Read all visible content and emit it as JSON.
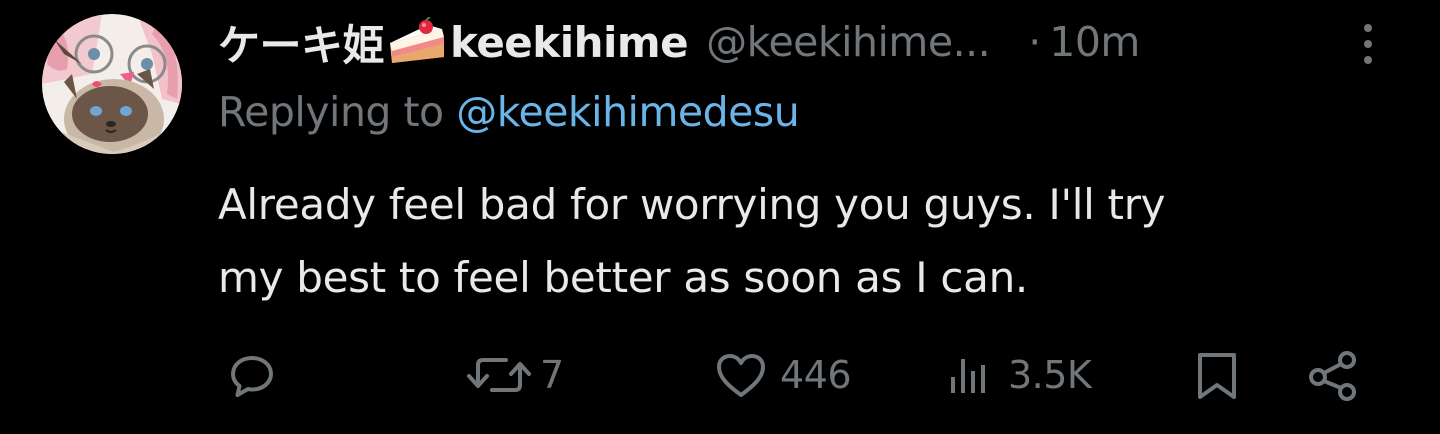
{
  "tweet": {
    "author": {
      "display_name": "ケーキ姫",
      "username_text": "keekihime",
      "handle": "@keekihime...",
      "avatar_icon": "avatar-cat-anime-icon"
    },
    "separator": "·",
    "time": "10m",
    "more_icon": "more-vertical-icon",
    "reply": {
      "prefix": "Replying to",
      "handle": "@keekihimedesu"
    },
    "text_lines": [
      "Already feel bad for worrying you guys. I'll try",
      "my best to feel better as soon as I can."
    ],
    "actions": {
      "reply": {
        "icon": "reply-icon"
      },
      "retweet": {
        "icon": "retweet-icon",
        "count": "7"
      },
      "like": {
        "icon": "heart-icon",
        "count": "446"
      },
      "views": {
        "icon": "views-icon",
        "count": "3.5K"
      },
      "bookmark": {
        "icon": "bookmark-icon"
      },
      "share": {
        "icon": "share-icon"
      }
    }
  },
  "colors": {
    "background": "#000000",
    "text": "#e7e9ea",
    "muted": "#71767b",
    "link": "#6ab4e8"
  }
}
